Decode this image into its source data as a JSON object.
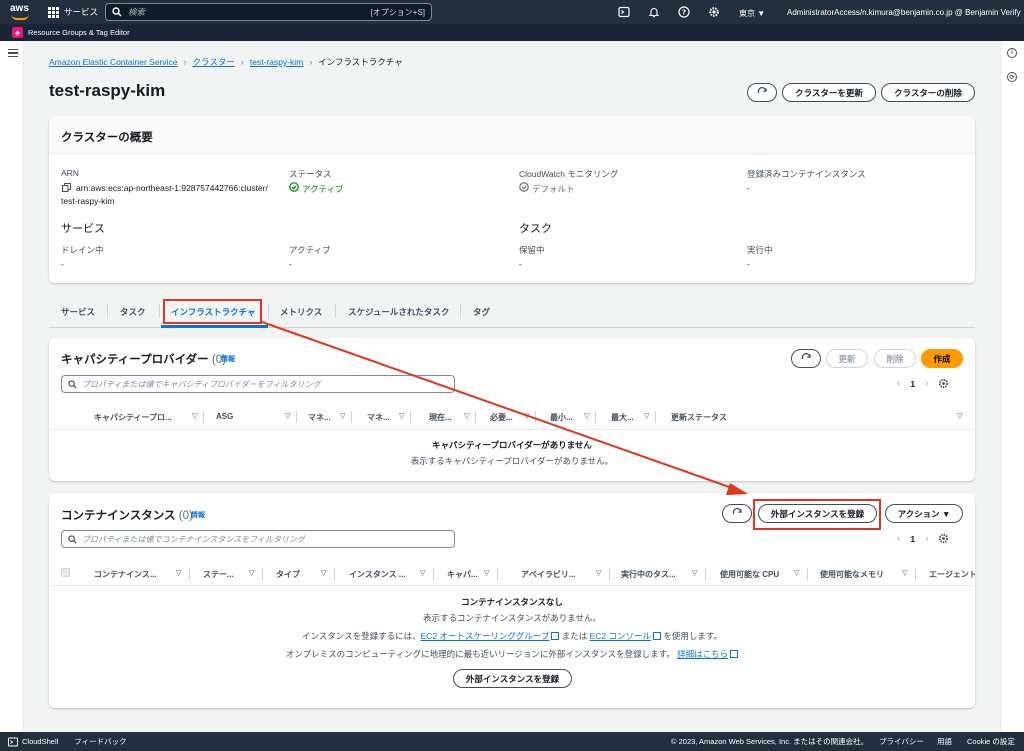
{
  "topnav": {
    "logo": "aws",
    "services": "サービス",
    "search_placeholder": "検索",
    "shortcut": "[オプション+S]",
    "region": "東京 ▼",
    "account": "AdministratorAccess/n.kimura@benjamin.co.jp @ Benjamin Verify ▼"
  },
  "rgbar": {
    "label": "Resource Groups & Tag Editor"
  },
  "breadcrumb": [
    {
      "label": "Amazon Elastic Container Service"
    },
    {
      "label": "クラスター"
    },
    {
      "label": "test-raspy-kim"
    },
    {
      "label": "インフラストラクチャ"
    }
  ],
  "page": {
    "title": "test-raspy-kim",
    "update_button": "クラスターを更新",
    "delete_button": "クラスターの削除"
  },
  "overview": {
    "title": "クラスターの概要",
    "arn_label": "ARN",
    "arn_line1": "arn:aws:ecs:ap-northeast-1:928757442766:cluster/",
    "arn_line2": "test-raspy-kim",
    "status_label": "ステータス",
    "status_value": "アクティブ",
    "cw_label": "CloudWatch モニタリング",
    "cw_value": "デフォルト",
    "reg_label": "登録済みコンテナインスタンス",
    "reg_value": "-",
    "services_title": "サービス",
    "tasks_title": "タスク",
    "drain_label": "ドレイン中",
    "drain_value": "-",
    "active_label": "アクティブ",
    "active_value": "-",
    "pending_label": "保留中",
    "pending_value": "-",
    "running_label": "実行中",
    "running_value": "-"
  },
  "tabs": [
    "サービス",
    "タスク",
    "インフラストラクチャ",
    "メトリクス",
    "スケジュールされたタスク",
    "タグ"
  ],
  "capacity": {
    "title": "キャパシティープロバイダー",
    "count": "(0)",
    "info": "情報",
    "update": "更新",
    "delete": "削除",
    "create": "作成",
    "filter_placeholder": "プロパティまたは値でキャパシティプロバイダーをフィルタリング",
    "page": "1",
    "columns": [
      "キャパシティープロ...",
      "ASG",
      "マネ...",
      "マネ...",
      "現在...",
      "必要...",
      "最小...",
      "最大...",
      "更新ステータス"
    ],
    "empty_title": "キャパシティープロバイダーがありません",
    "empty_desc": "表示するキャパシティープロバイダーがありません。"
  },
  "containers": {
    "title": "コンテナインスタンス",
    "count": "(0)",
    "info": "情報",
    "register": "外部インスタンスを登録",
    "actions": "アクション ▼",
    "filter_placeholder": "プロパティまたは値でコンテナインスタンスをフィルタリング",
    "page": "1",
    "columns": [
      "コンテナインス...",
      "ステー...",
      "タイプ",
      "インスタンス ...",
      "キャパ...",
      "アベイラビリ...",
      "実行中のタス...",
      "使用可能な CPU",
      "使用可能なメモリ",
      "エージェント"
    ],
    "empty_title": "コンテナインスタンスなし",
    "empty_desc": "表示するコンテナインスタンスがありません。",
    "help1_pre": "インスタンスを登録するには、",
    "help1_link1": "EC2 オートスケーリンググループ",
    "help1_mid": " または ",
    "help1_link2": "EC2 コンソール",
    "help1_post": " を使用します。",
    "help2_pre": "オンプレミスのコンピューティングに地理的に最も近いリージョンに外部インスタンスを登録します。",
    "help2_link": "詳細はこちら",
    "register_bottom": "外部インスタンスを登録"
  },
  "footer": {
    "cloudshell": "CloudShell",
    "feedback": "フィードバック",
    "copyright": "© 2023, Amazon Web Services, Inc. またはその関連会社。",
    "privacy": "プライバシー",
    "terms": "用語",
    "cookie": "Cookie の設定"
  }
}
